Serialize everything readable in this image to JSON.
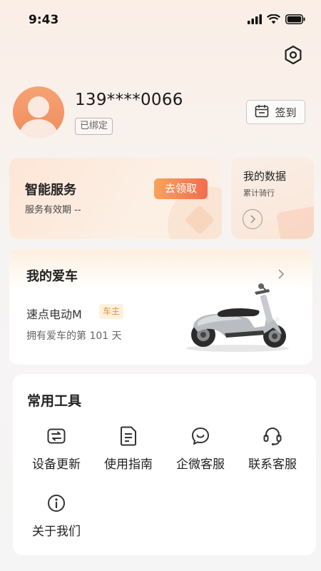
{
  "status_bar": {
    "time": "9:43"
  },
  "profile": {
    "phone": "139****0066",
    "bound_label": "已绑定",
    "checkin_label": "签到"
  },
  "service": {
    "title": "智能服务",
    "subtitle": "服务有效期 --",
    "claim_label": "去领取"
  },
  "my_data": {
    "title": "我的数据",
    "subtitle": "累计骑行"
  },
  "car": {
    "title": "我的爱车",
    "model": "速点电动M",
    "owner_badge": "车主",
    "days_text": "拥有爱车的第 101 天"
  },
  "tools": {
    "title": "常用工具",
    "items": [
      {
        "label": "设备更新",
        "icon": "device-update-icon"
      },
      {
        "label": "使用指南",
        "icon": "document-icon"
      },
      {
        "label": "企微客服",
        "icon": "chat-bubble-icon"
      },
      {
        "label": "联系客服",
        "icon": "headset-icon"
      },
      {
        "label": "关于我们",
        "icon": "info-icon"
      }
    ]
  },
  "colors": {
    "accent_orange": "#f26d4e",
    "avatar_orange": "#f08d5c",
    "owner_badge_text": "#e1953a"
  }
}
